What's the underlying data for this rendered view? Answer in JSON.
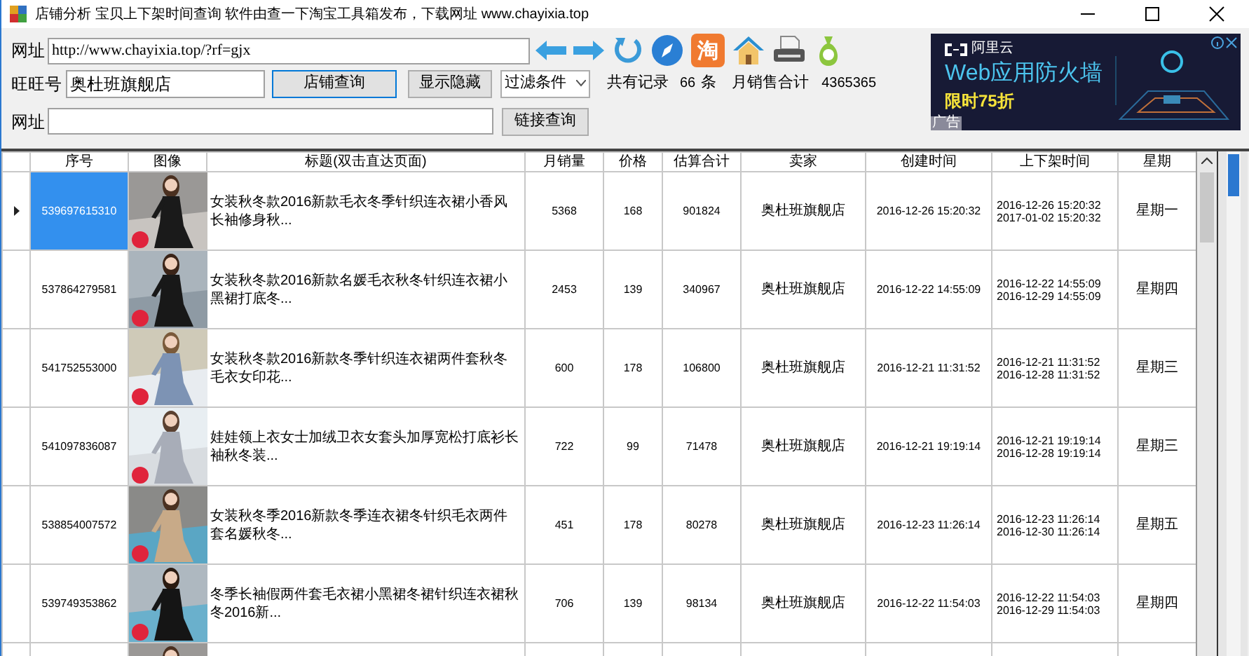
{
  "window": {
    "title": "店铺分析 宝贝上下架时间查询  软件由查一下淘宝工具箱发布，下载网址 www.chayixia.top"
  },
  "address": {
    "label": "网址",
    "value": "http://www.chayixia.top/?rf=gjx"
  },
  "toolbar": {
    "taobao_label": "淘"
  },
  "wangwang": {
    "label": "旺旺号",
    "value": "奥杜班旗舰店"
  },
  "shop_query_button": {
    "label": "店铺查询",
    "focused": true
  },
  "toggle_button": {
    "label": "显示隐藏"
  },
  "filter": {
    "value": "过滤条件"
  },
  "summary": {
    "records_label": "共有记录",
    "count": "66",
    "unit": "条",
    "sales_label": "月销售合计",
    "sales": "4365365"
  },
  "link": {
    "label": "网址",
    "button": "链接查询"
  },
  "ad": {
    "brand": "阿里云",
    "headline": "Web应用防火墙",
    "offer": "限时75折",
    "tag": "广告"
  },
  "table": {
    "columns": [
      "序号",
      "图像",
      "标题(双击直达页面)",
      "月销量",
      "价格",
      "估算合计",
      "卖家",
      "创建时间",
      "上下架时间",
      "星期"
    ],
    "rows": [
      {
        "selected": true,
        "id": "539697615310",
        "title": "女装秋冬款2016新款毛衣冬季针织连衣裙小香风长袖修身秋...",
        "monthly_sales": "5368",
        "price": "168",
        "estimated_total": "901824",
        "seller": "奥杜班旗舰店",
        "created": "2016-12-26 15:20:32",
        "listing_times": [
          "2016-12-26 15:20:32",
          "2017-01-02 15:20:32"
        ],
        "weekday": "星期一"
      },
      {
        "selected": false,
        "id": "537864279581",
        "title": "女装秋冬款2016新款名媛毛衣秋冬针织连衣裙小黑裙打底冬...",
        "monthly_sales": "2453",
        "price": "139",
        "estimated_total": "340967",
        "seller": "奥杜班旗舰店",
        "created": "2016-12-22 14:55:09",
        "listing_times": [
          "2016-12-22 14:55:09",
          "2016-12-29 14:55:09"
        ],
        "weekday": "星期四"
      },
      {
        "selected": false,
        "id": "541752553000",
        "title": "女装秋冬款2016新款冬季针织连衣裙两件套秋冬毛衣女印花...",
        "monthly_sales": "600",
        "price": "178",
        "estimated_total": "106800",
        "seller": "奥杜班旗舰店",
        "created": "2016-12-21 11:31:52",
        "listing_times": [
          "2016-12-21 11:31:52",
          "2016-12-28 11:31:52"
        ],
        "weekday": "星期三"
      },
      {
        "selected": false,
        "id": "541097836087",
        "title": "娃娃领上衣女士加绒卫衣女套头加厚宽松打底衫长袖秋冬装...",
        "monthly_sales": "722",
        "price": "99",
        "estimated_total": "71478",
        "seller": "奥杜班旗舰店",
        "created": "2016-12-21 19:19:14",
        "listing_times": [
          "2016-12-21 19:19:14",
          "2016-12-28 19:19:14"
        ],
        "weekday": "星期三"
      },
      {
        "selected": false,
        "id": "538854007572",
        "title": "女装秋冬季2016新款冬季连衣裙冬针织毛衣两件套名媛秋冬...",
        "monthly_sales": "451",
        "price": "178",
        "estimated_total": "80278",
        "seller": "奥杜班旗舰店",
        "created": "2016-12-23 11:26:14",
        "listing_times": [
          "2016-12-23 11:26:14",
          "2016-12-30 11:26:14"
        ],
        "weekday": "星期五"
      },
      {
        "selected": false,
        "id": "539749353862",
        "title": "冬季长袖假两件套毛衣裙小黑裙冬裙针织连衣裙秋冬2016新...",
        "monthly_sales": "706",
        "price": "139",
        "estimated_total": "98134",
        "seller": "奥杜班旗舰店",
        "created": "2016-12-22 11:54:03",
        "listing_times": [
          "2016-12-22 11:54:03",
          "2016-12-29 11:54:03"
        ],
        "weekday": "星期四"
      }
    ]
  }
}
